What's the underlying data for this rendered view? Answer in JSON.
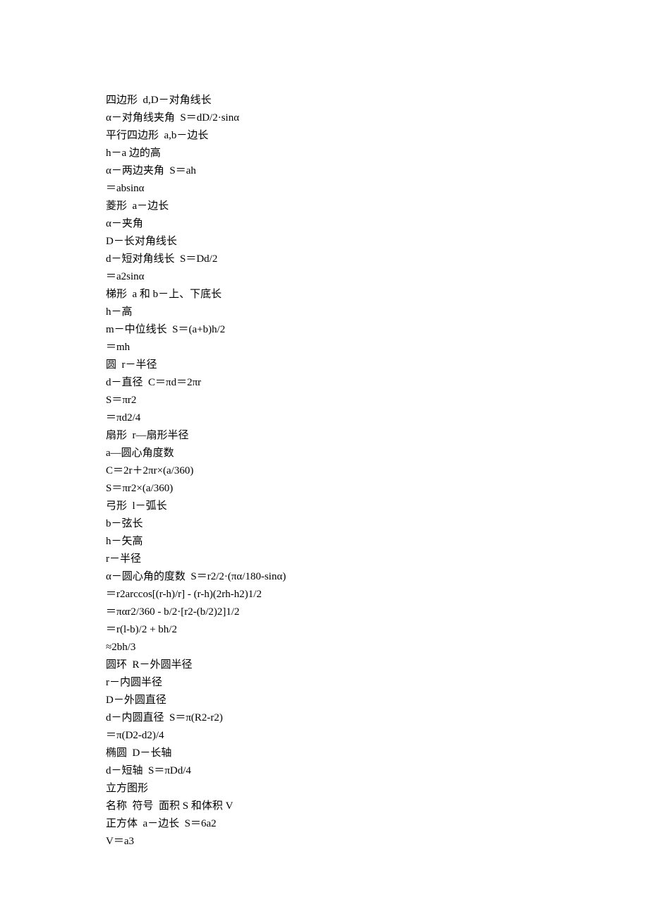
{
  "lines": [
    "四边形  d,D－对角线长",
    "α－对角线夹角  S＝dD/2·sinα",
    "平行四边形  a,b－边长",
    "h－a 边的高",
    "α－两边夹角  S＝ah",
    "＝absinα",
    "菱形  a－边长",
    "α－夹角",
    "D－长对角线长",
    "d－短对角线长  S＝Dd/2",
    "＝a2sinα",
    "梯形  a 和 b－上、下底长",
    "h－高",
    "m－中位线长  S＝(a+b)h/2",
    "＝mh",
    "圆  r－半径",
    "d－直径  C＝πd＝2πr",
    "S＝πr2",
    "＝πd2/4",
    "扇形  r—扇形半径",
    "a—圆心角度数",
    "C＝2r＋2πr×(a/360)",
    "S＝πr2×(a/360)",
    "弓形  l－弧长",
    "b－弦长",
    "h－矢高",
    "r－半径",
    "α－圆心角的度数  S＝r2/2·(πα/180-sinα)",
    "＝r2arccos[(r-h)/r] - (r-h)(2rh-h2)1/2",
    "＝παr2/360 - b/2·[r2-(b/2)2]1/2",
    "＝r(l-b)/2 + bh/2",
    "≈2bh/3",
    "圆环  R－外圆半径",
    "r－内圆半径",
    "D－外圆直径",
    "d－内圆直径  S＝π(R2-r2)",
    "＝π(D2-d2)/4",
    "椭圆  D－长轴",
    "d－短轴  S＝πDd/4",
    "立方图形",
    "名称  符号  面积 S 和体积 V",
    "正方体  a－边长  S＝6a2",
    "V＝a3"
  ]
}
